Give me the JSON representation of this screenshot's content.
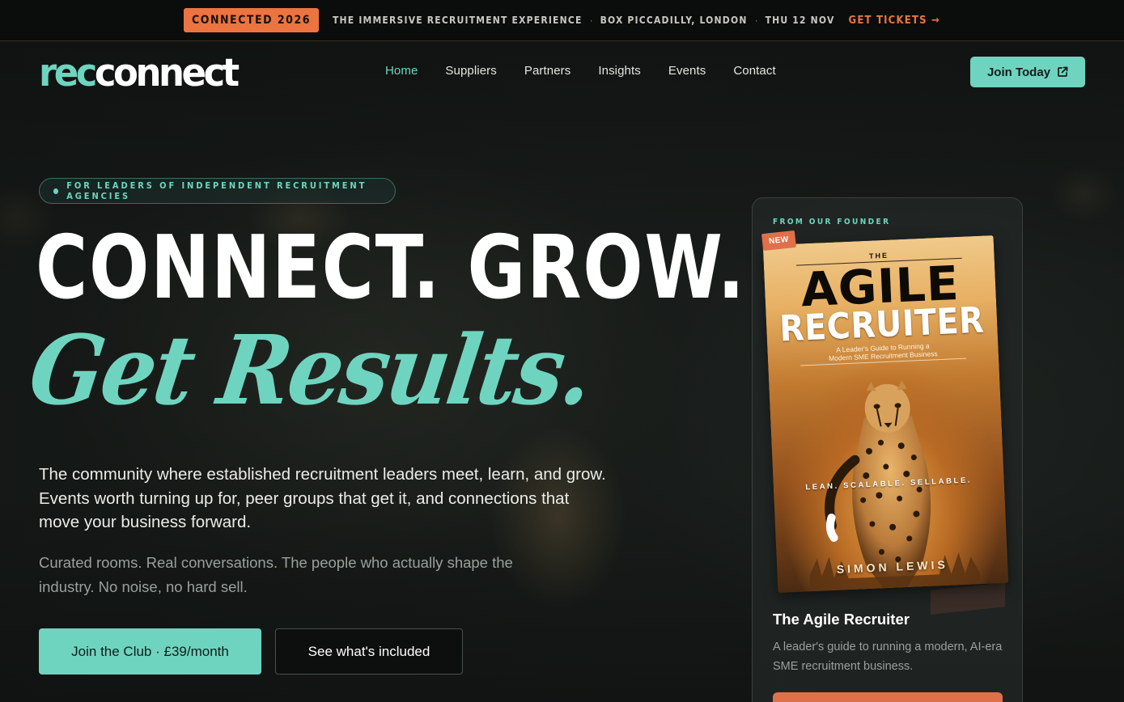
{
  "announcement": {
    "badge": "CONNECTED 2026",
    "tagline": "THE IMMERSIVE RECRUITMENT EXPERIENCE",
    "separator": "·",
    "venue": "BOX PICCADILLY, LONDON",
    "date": "THU 12 NOV",
    "tickets_label": "GET TICKETS →"
  },
  "logo": {
    "part1": "rec",
    "part2": "connect"
  },
  "nav": {
    "items": [
      {
        "label": "Home",
        "active": true
      },
      {
        "label": "Suppliers"
      },
      {
        "label": "Partners"
      },
      {
        "label": "Insights"
      },
      {
        "label": "Events"
      },
      {
        "label": "Contact"
      }
    ],
    "join_label": "Join Today",
    "join_icon": "external-link-icon"
  },
  "hero": {
    "eyebrow": "FOR LEADERS OF INDEPENDENT RECRUITMENT AGENCIES",
    "headline": "CONNECT. GROW.",
    "script_headline": "Get Results.",
    "lead": "The community where established recruitment leaders meet, learn, and grow. Events worth turning up for, peer groups that get it, and connections that move your business forward.",
    "sub": "Curated rooms. Real conversations. The people who actually shape the industry. No noise, no hard sell.",
    "primary_cta": "Join the Club · £39/month",
    "secondary_cta": "See what's included"
  },
  "founder": {
    "eyebrow": "FROM OUR FOUNDER",
    "badge": "NEW",
    "cover": {
      "the": "THE",
      "title1": "AGILE",
      "title2": "RECRUITER",
      "subtitle_line1": "A Leader's Guide to Running a",
      "subtitle_line2": "Modern SME Recruitment Business",
      "tagline": "LEAN. SCALABLE. SELLABLE.",
      "author": "SIMON LEWIS"
    },
    "title": "The Agile Recruiter",
    "description": "A leader's guide to running a modern, AI-era SME recruitment business."
  },
  "colors": {
    "accent": "#6fd4bf",
    "orange": "#ec7440",
    "background": "#141816"
  }
}
